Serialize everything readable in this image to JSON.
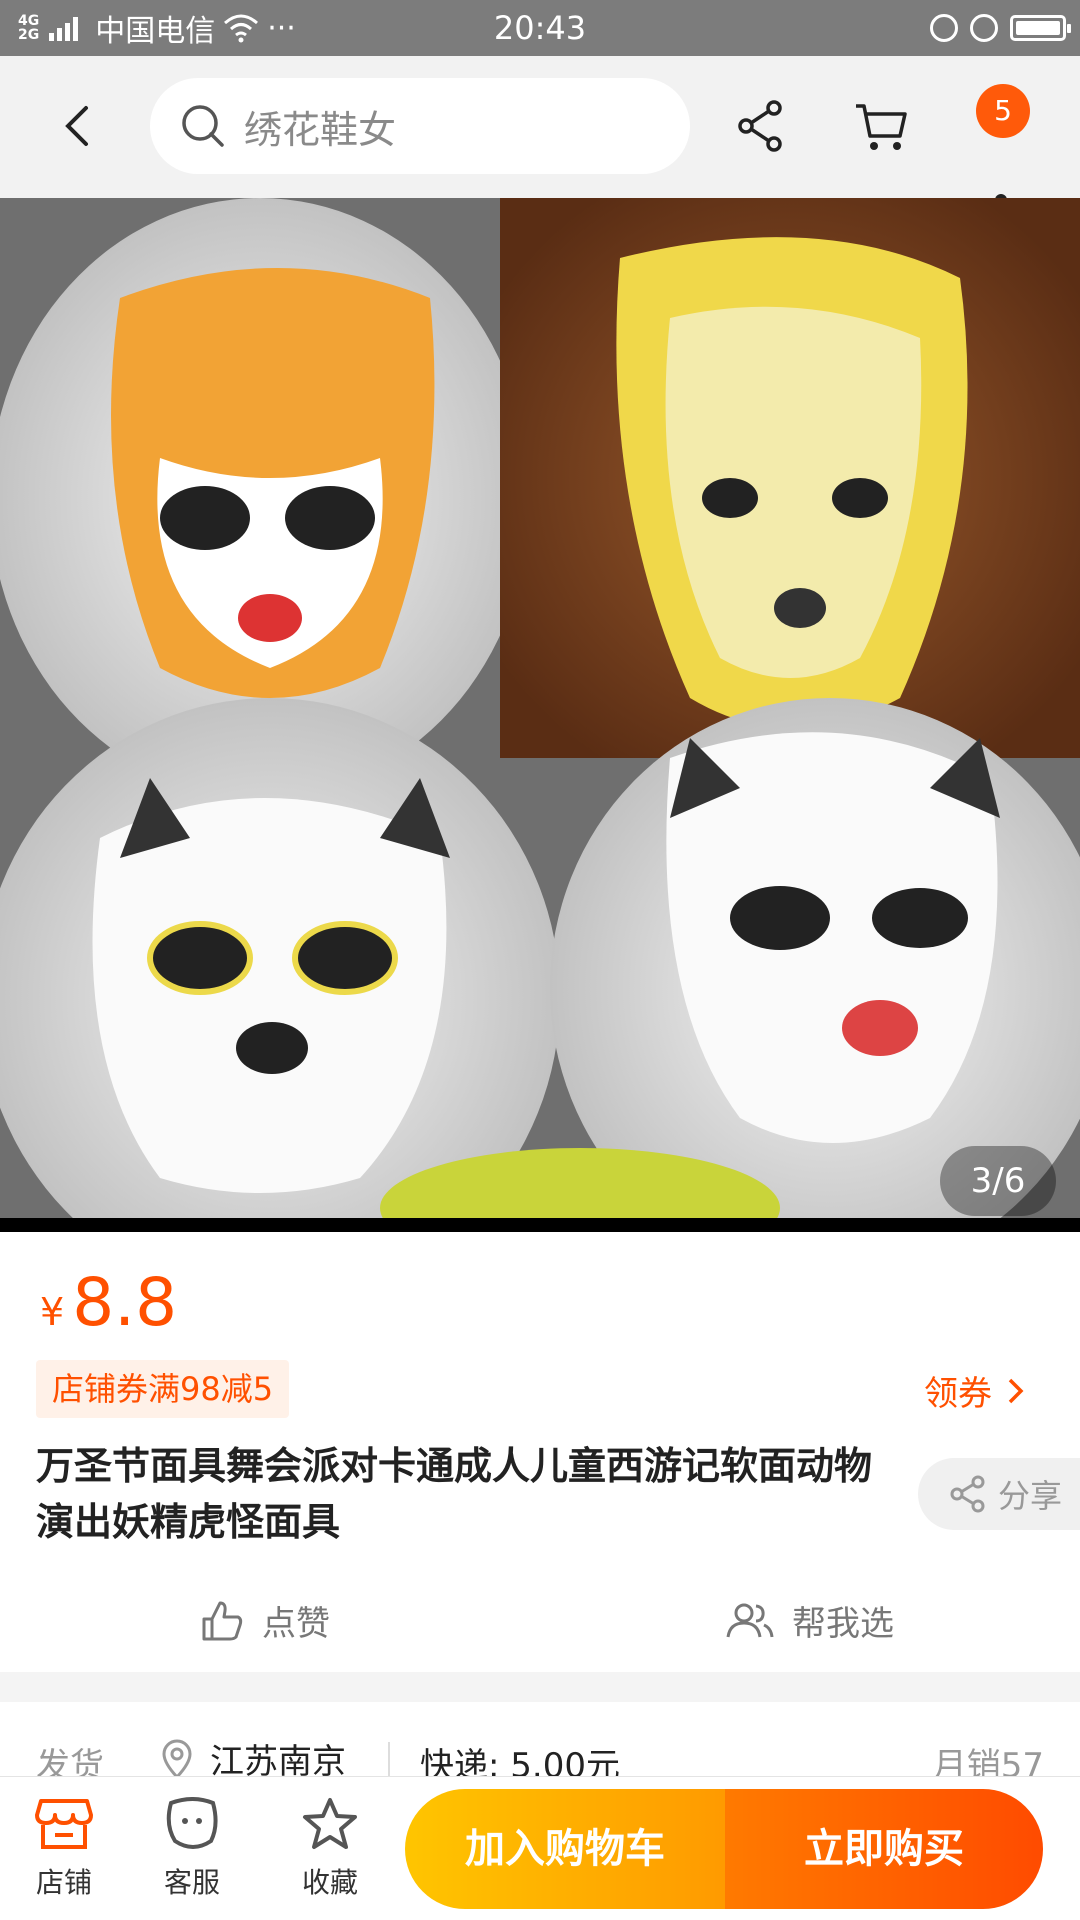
{
  "status_bar": {
    "network": [
      "4G",
      "2G"
    ],
    "carrier": "中国电信",
    "dots": "···",
    "time": "20:43"
  },
  "nav": {
    "search_placeholder": "绣花鞋女",
    "cart_badge": "5"
  },
  "gallery": {
    "counter": "3/6",
    "icons": [
      "tiger-mask",
      "lion-mask",
      "white-tiger-mask",
      "snow-leopard-mask"
    ]
  },
  "product": {
    "currency": "¥",
    "price": "8.8",
    "coupon": "店铺券满98减5",
    "get_coupon": "领券",
    "title": "万圣节面具舞会派对卡通成人儿童西游记软面动物演出妖精虎怪面具",
    "share": "分享",
    "like": "点赞",
    "help_choose": "帮我选"
  },
  "shipping": {
    "label": "发货",
    "location": "江苏南京",
    "fee": "快递: 5.00元",
    "monthly_sales": "月销57"
  },
  "bottom_bar": {
    "shop": "店铺",
    "service": "客服",
    "favorite": "收藏",
    "add_to_cart": "加入购物车",
    "buy_now": "立即购买"
  },
  "colors": {
    "accent": "#ff5000",
    "cart_button": "#ffb000",
    "buy_button": "#ff5a00",
    "status_bar": "#7c7c7c"
  }
}
